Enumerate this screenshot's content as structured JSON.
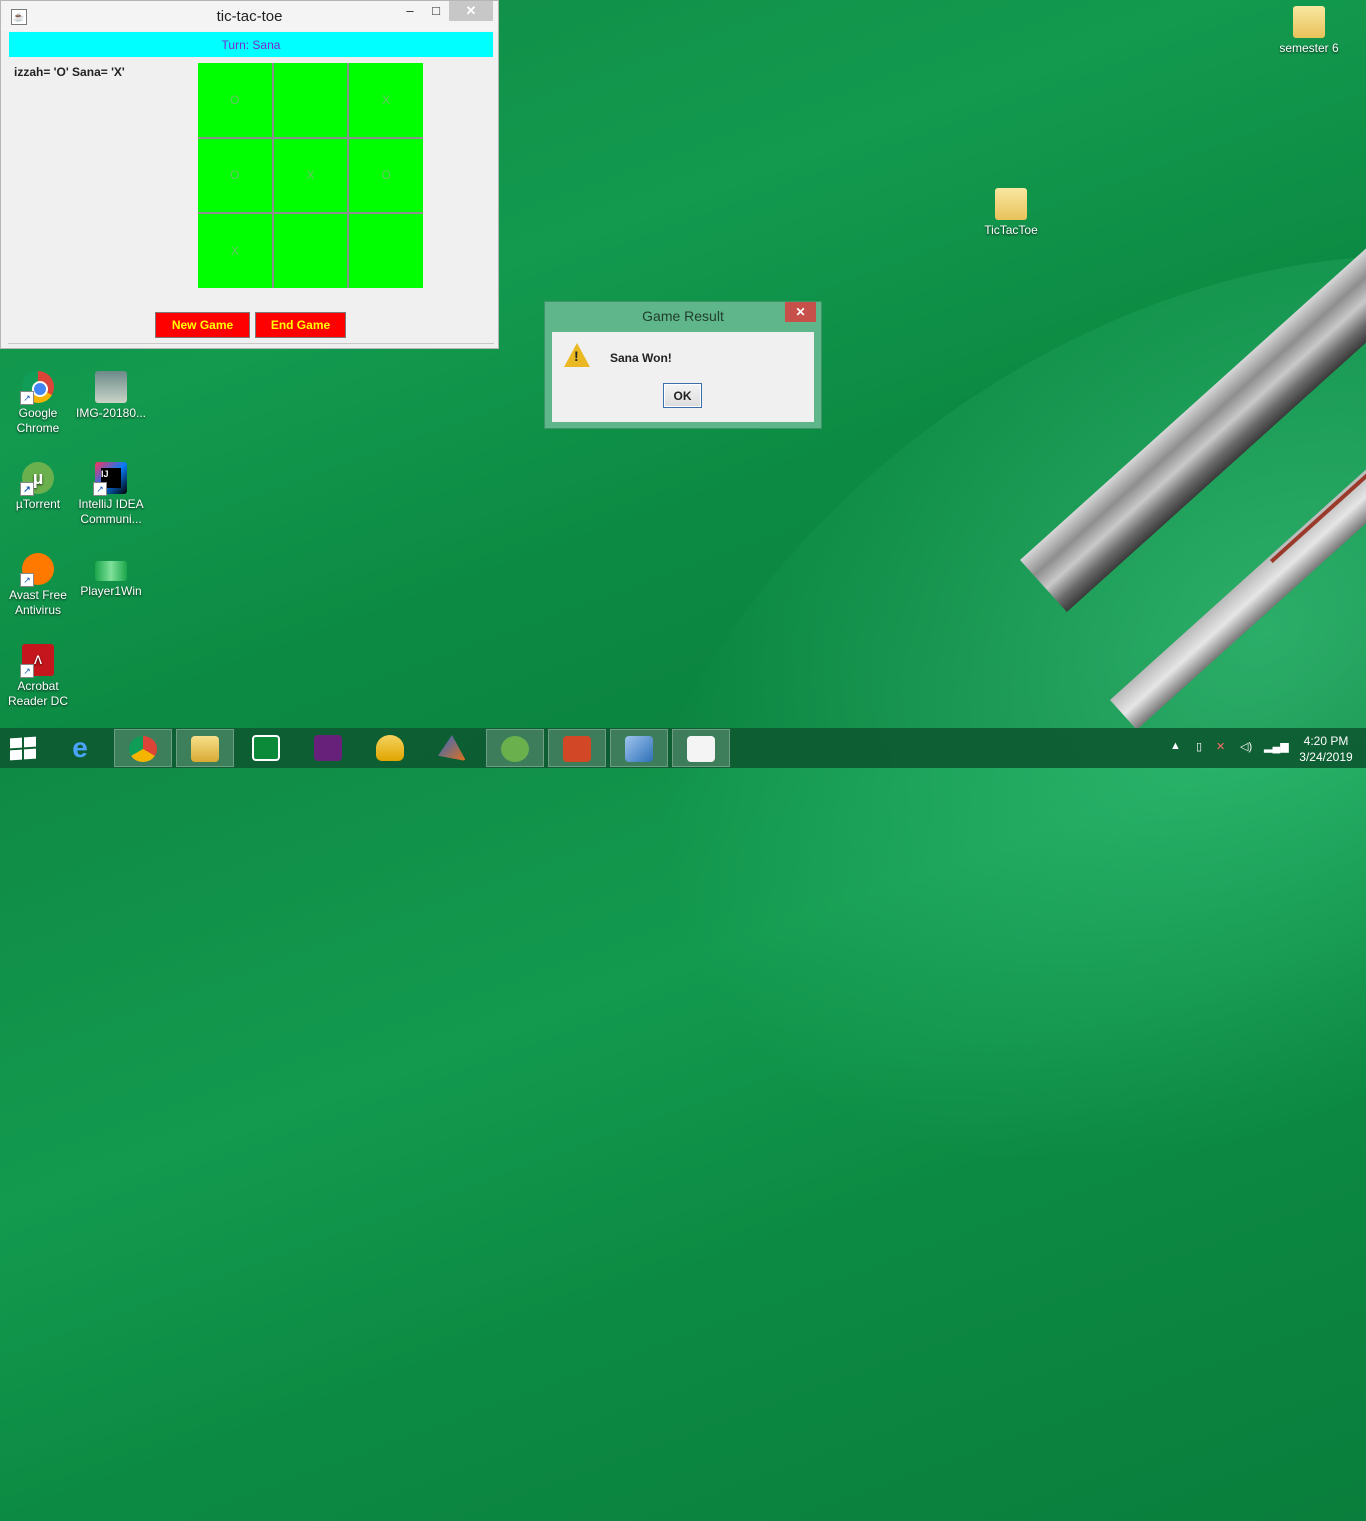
{
  "window": {
    "title": "tic-tac-toe",
    "minimize": "–",
    "maximize": "□",
    "close": "✕",
    "turn_label": "Turn: Sana",
    "players_label": "izzah= 'O'  Sana= 'X'",
    "board": [
      "O",
      "",
      "X",
      "O",
      "X",
      "O",
      "X",
      "",
      ""
    ],
    "new_game_label": "New Game",
    "end_game_label": "End Game",
    "colors": {
      "turn_bar": "#00ffff",
      "board": "#00ff00",
      "buttons": "#ff0000",
      "button_text": "#ffff00"
    }
  },
  "dialog": {
    "title": "Game Result",
    "message": "Sana Won!",
    "ok_label": "OK",
    "close": "✕",
    "icon": "warning-icon"
  },
  "desktop_icons": [
    {
      "label": "semester 6",
      "icon": "folder-icon"
    },
    {
      "label": "TicTacToe",
      "icon": "folder-icon"
    },
    {
      "label": "Google Chrome",
      "icon": "chrome-icon"
    },
    {
      "label": "IMG-20180...",
      "icon": "image-icon"
    },
    {
      "label": "µTorrent",
      "icon": "utorrent-icon"
    },
    {
      "label": "IntelliJ IDEA Communi...",
      "icon": "intellij-icon"
    },
    {
      "label": "Avast Free Antivirus",
      "icon": "avast-icon"
    },
    {
      "label": "Player1Win",
      "icon": "image-icon"
    },
    {
      "label": "Acrobat Reader DC",
      "icon": "acrobat-icon"
    }
  ],
  "taskbar": {
    "apps": [
      "internet-explorer-icon",
      "chrome-icon",
      "file-explorer-icon",
      "store-icon",
      "visual-studio-icon",
      "db-tools-icon",
      "matlab-icon",
      "utorrent-icon",
      "powerpoint-icon",
      "virtualbox-icon",
      "java-icon"
    ],
    "time": "4:20 PM",
    "date": "3/24/2019"
  }
}
